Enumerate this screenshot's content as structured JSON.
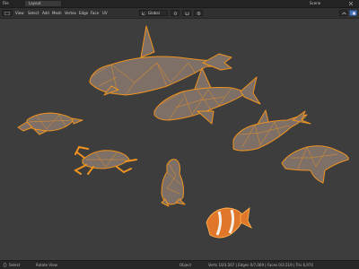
{
  "topbar": {
    "file_label": "File",
    "tab_label": "Layout",
    "scene_label": "Scene"
  },
  "toolbar": {
    "menus": [
      "View",
      "Select",
      "Add",
      "Mesh",
      "Vertex",
      "Edge",
      "Face",
      "UV"
    ],
    "transform_orientation": "Global"
  },
  "viewport": {
    "objects": [
      "orca",
      "shark",
      "dolphin",
      "seal",
      "turtle",
      "crab",
      "penguin",
      "clownfish"
    ],
    "wire_color": "#f0931f",
    "body_color": "#7e7066"
  },
  "statusbar": {
    "left_text": "Select",
    "middle_text": "Rotate View",
    "mode_text": "Object",
    "stats_text": "Verts 10/3,567 | Edges 0/7,069 | Faces 0/3,519 | Tris 6,974"
  }
}
